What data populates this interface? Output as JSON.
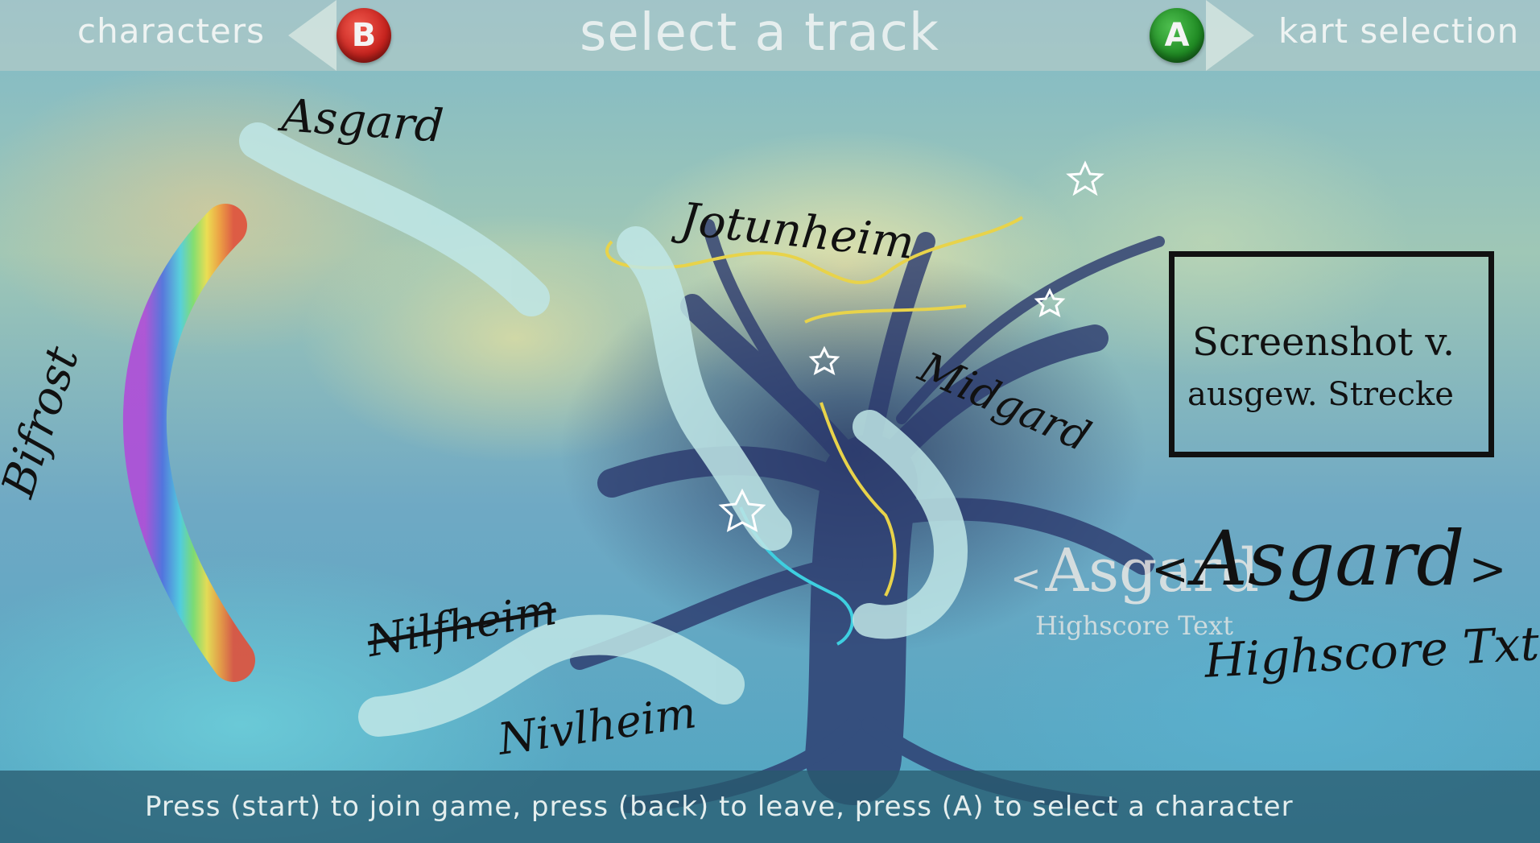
{
  "header": {
    "title": "select a track",
    "left_label": "characters",
    "left_button": "B",
    "right_button": "A",
    "right_label": "kart selection"
  },
  "map": {
    "realms": {
      "asgard": "Asgard",
      "jotunheim": "Jotunheim",
      "midgard": "Midgard",
      "bifrost": "Bifrost",
      "nilfheim_struck": "Nilfheim",
      "nivlheim": "Nivlheim"
    }
  },
  "selection": {
    "overlay_prev": "<",
    "overlay_name": "Asgard",
    "overlay_next": ">",
    "overlay_highscore": "Highscore Text",
    "sketch_prev": "<",
    "sketch_name": "Asgard",
    "sketch_next": ">",
    "sketch_highscore": "Highscore Txt"
  },
  "preview_box": {
    "line1": "Screenshot v.",
    "line2": "ausgew. Strecke"
  },
  "footer": {
    "instructions": "Press (start) to join game, press (back) to leave, press (A) to select a character"
  },
  "colors": {
    "button_b": "#c8231e",
    "button_a": "#1f8a23",
    "track_path": "#bfe6e6",
    "route_yellow": "#e8d34a",
    "route_cyan": "#3ecfe0"
  }
}
